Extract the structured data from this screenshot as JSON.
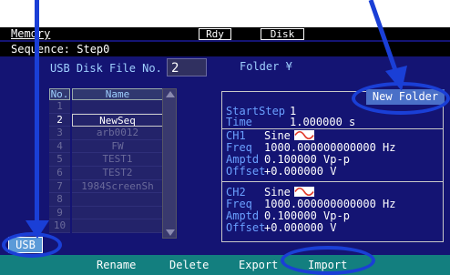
{
  "header": {
    "menu_title": "Memory",
    "rdy": "Rdy",
    "disk": "Disk",
    "sequence": "Sequence: Step0"
  },
  "file_no": {
    "label": "USB Disk File No.",
    "value": "2"
  },
  "folder": {
    "label": "Folder ¥"
  },
  "list": {
    "headers": {
      "no": "No.",
      "name": "Name"
    },
    "rows": [
      {
        "no": "1",
        "name": ""
      },
      {
        "no": "2",
        "name": "NewSeq"
      },
      {
        "no": "3",
        "name": "arb0012"
      },
      {
        "no": "4",
        "name": "FW"
      },
      {
        "no": "5",
        "name": "TEST1"
      },
      {
        "no": "6",
        "name": "TEST2"
      },
      {
        "no": "7",
        "name": "1984ScreenSh"
      },
      {
        "no": "8",
        "name": ""
      },
      {
        "no": "9",
        "name": ""
      },
      {
        "no": "10",
        "name": ""
      }
    ]
  },
  "new_folder": "New Folder",
  "details": {
    "start_step_key": "StartStep",
    "start_step_val": "1",
    "time_key": "Time",
    "time_val": "1.000000 s",
    "ch1": {
      "ch_key": "CH1",
      "wave": "Sine",
      "freq_key": "Freq",
      "freq_val": "1000.000000000000 Hz",
      "amptd_key": "Amptd",
      "amptd_val": "0.100000 Vp-p",
      "offset_key": "Offset",
      "offset_val": "+0.000000 V"
    },
    "ch2": {
      "ch_key": "CH2",
      "wave": "Sine",
      "freq_key": "Freq",
      "freq_val": "1000.000000000000 Hz",
      "amptd_key": "Amptd",
      "amptd_val": "0.100000 Vp-p",
      "offset_key": "Offset",
      "offset_val": "+0.000000 V"
    }
  },
  "softkeys": {
    "usb": "USB",
    "rename": "Rename",
    "delete": "Delete",
    "export": "Export",
    "import": "Import"
  },
  "colors": {
    "screen_bg": "#141473",
    "softkey_bar": "#137f7f",
    "annotation": "#1a3fd6",
    "accent_label": "#6aa0ff"
  }
}
